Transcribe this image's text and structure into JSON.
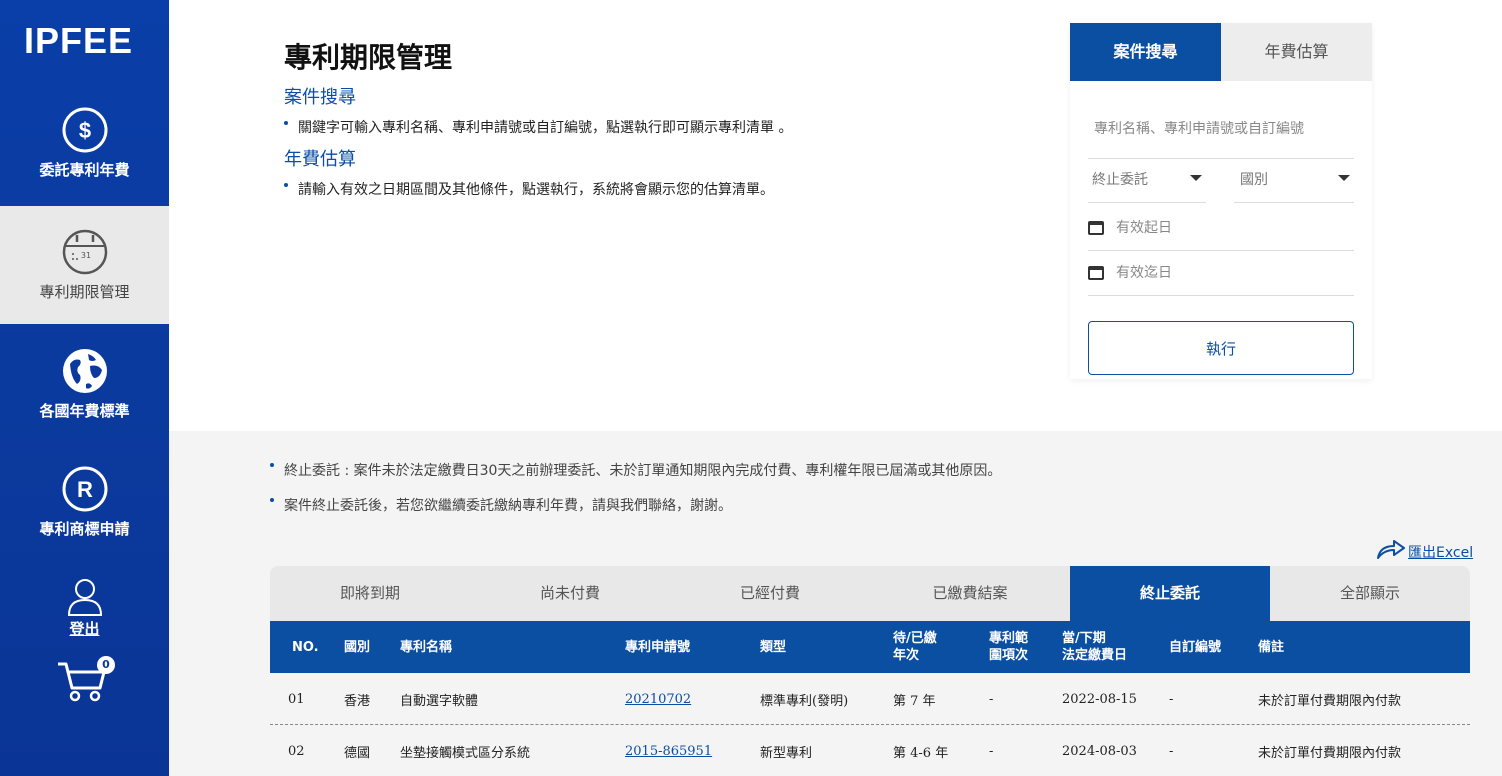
{
  "sidebar": {
    "logo": "IPFEE",
    "items": [
      {
        "label": "委託專利年費"
      },
      {
        "label": "專利期限管理"
      },
      {
        "label": "各國年費標準"
      },
      {
        "label": "專利商標申請"
      }
    ],
    "logout": "登出",
    "cart_count": "0"
  },
  "main": {
    "title": "專利期限管理",
    "sections": [
      {
        "heading": "案件搜尋",
        "text": "關鍵字可輸入專利名稱、專利申請號或自訂編號，點選執行即可顯示專利清單 。"
      },
      {
        "heading": "年費估算",
        "text": "請輸入有效之日期區間及其他條件，點選執行，系統將會顯示您的估算清單。"
      }
    ]
  },
  "panel": {
    "tabs": [
      "案件搜尋",
      "年費估算"
    ],
    "keyword_placeholder": "專利名稱、專利申請號或自訂編號",
    "status_select": "終止委託",
    "country_select": "國別",
    "start_date_placeholder": "有效起日",
    "end_date_placeholder": "有效迄日",
    "run_label": "執行"
  },
  "notes": [
    "終止委託 : 案件未於法定繳費日30天之前辦理委託、未於訂單通知期限內完成付費、專利權年限已屆滿或其他原因。",
    "案件終止委託後，若您欲繼續委託繳納專利年費，請與我們聯絡，謝謝。"
  ],
  "export_label": "匯出Excel",
  "status_tabs": [
    "即將到期",
    "尚未付費",
    "已經付費",
    "已繳費結案",
    "終止委託",
    "全部顯示"
  ],
  "table": {
    "headers": [
      "NO.",
      "國別",
      "專利名稱",
      "專利申請號",
      "類型",
      "待/已繳\n年次",
      "專利範\n圍項次",
      "當/下期\n法定繳費日",
      "自訂編號",
      "備註"
    ],
    "rows": [
      [
        "01",
        "香港",
        "自動選字軟體",
        "20210702",
        "標準專利(發明)",
        "第 7 年",
        "-",
        "2022-08-15",
        "-",
        "未於訂單付費期限內付款"
      ],
      [
        "02",
        "德國",
        "坐墊接觸模式區分系統",
        "2015-865951",
        "新型專利",
        "第 4-6 年",
        "-",
        "2024-08-03",
        "-",
        "未於訂單付費期限內付款"
      ]
    ]
  },
  "colors": {
    "brand": "#0b4fa3",
    "sidebar": "#0b3a9e"
  }
}
